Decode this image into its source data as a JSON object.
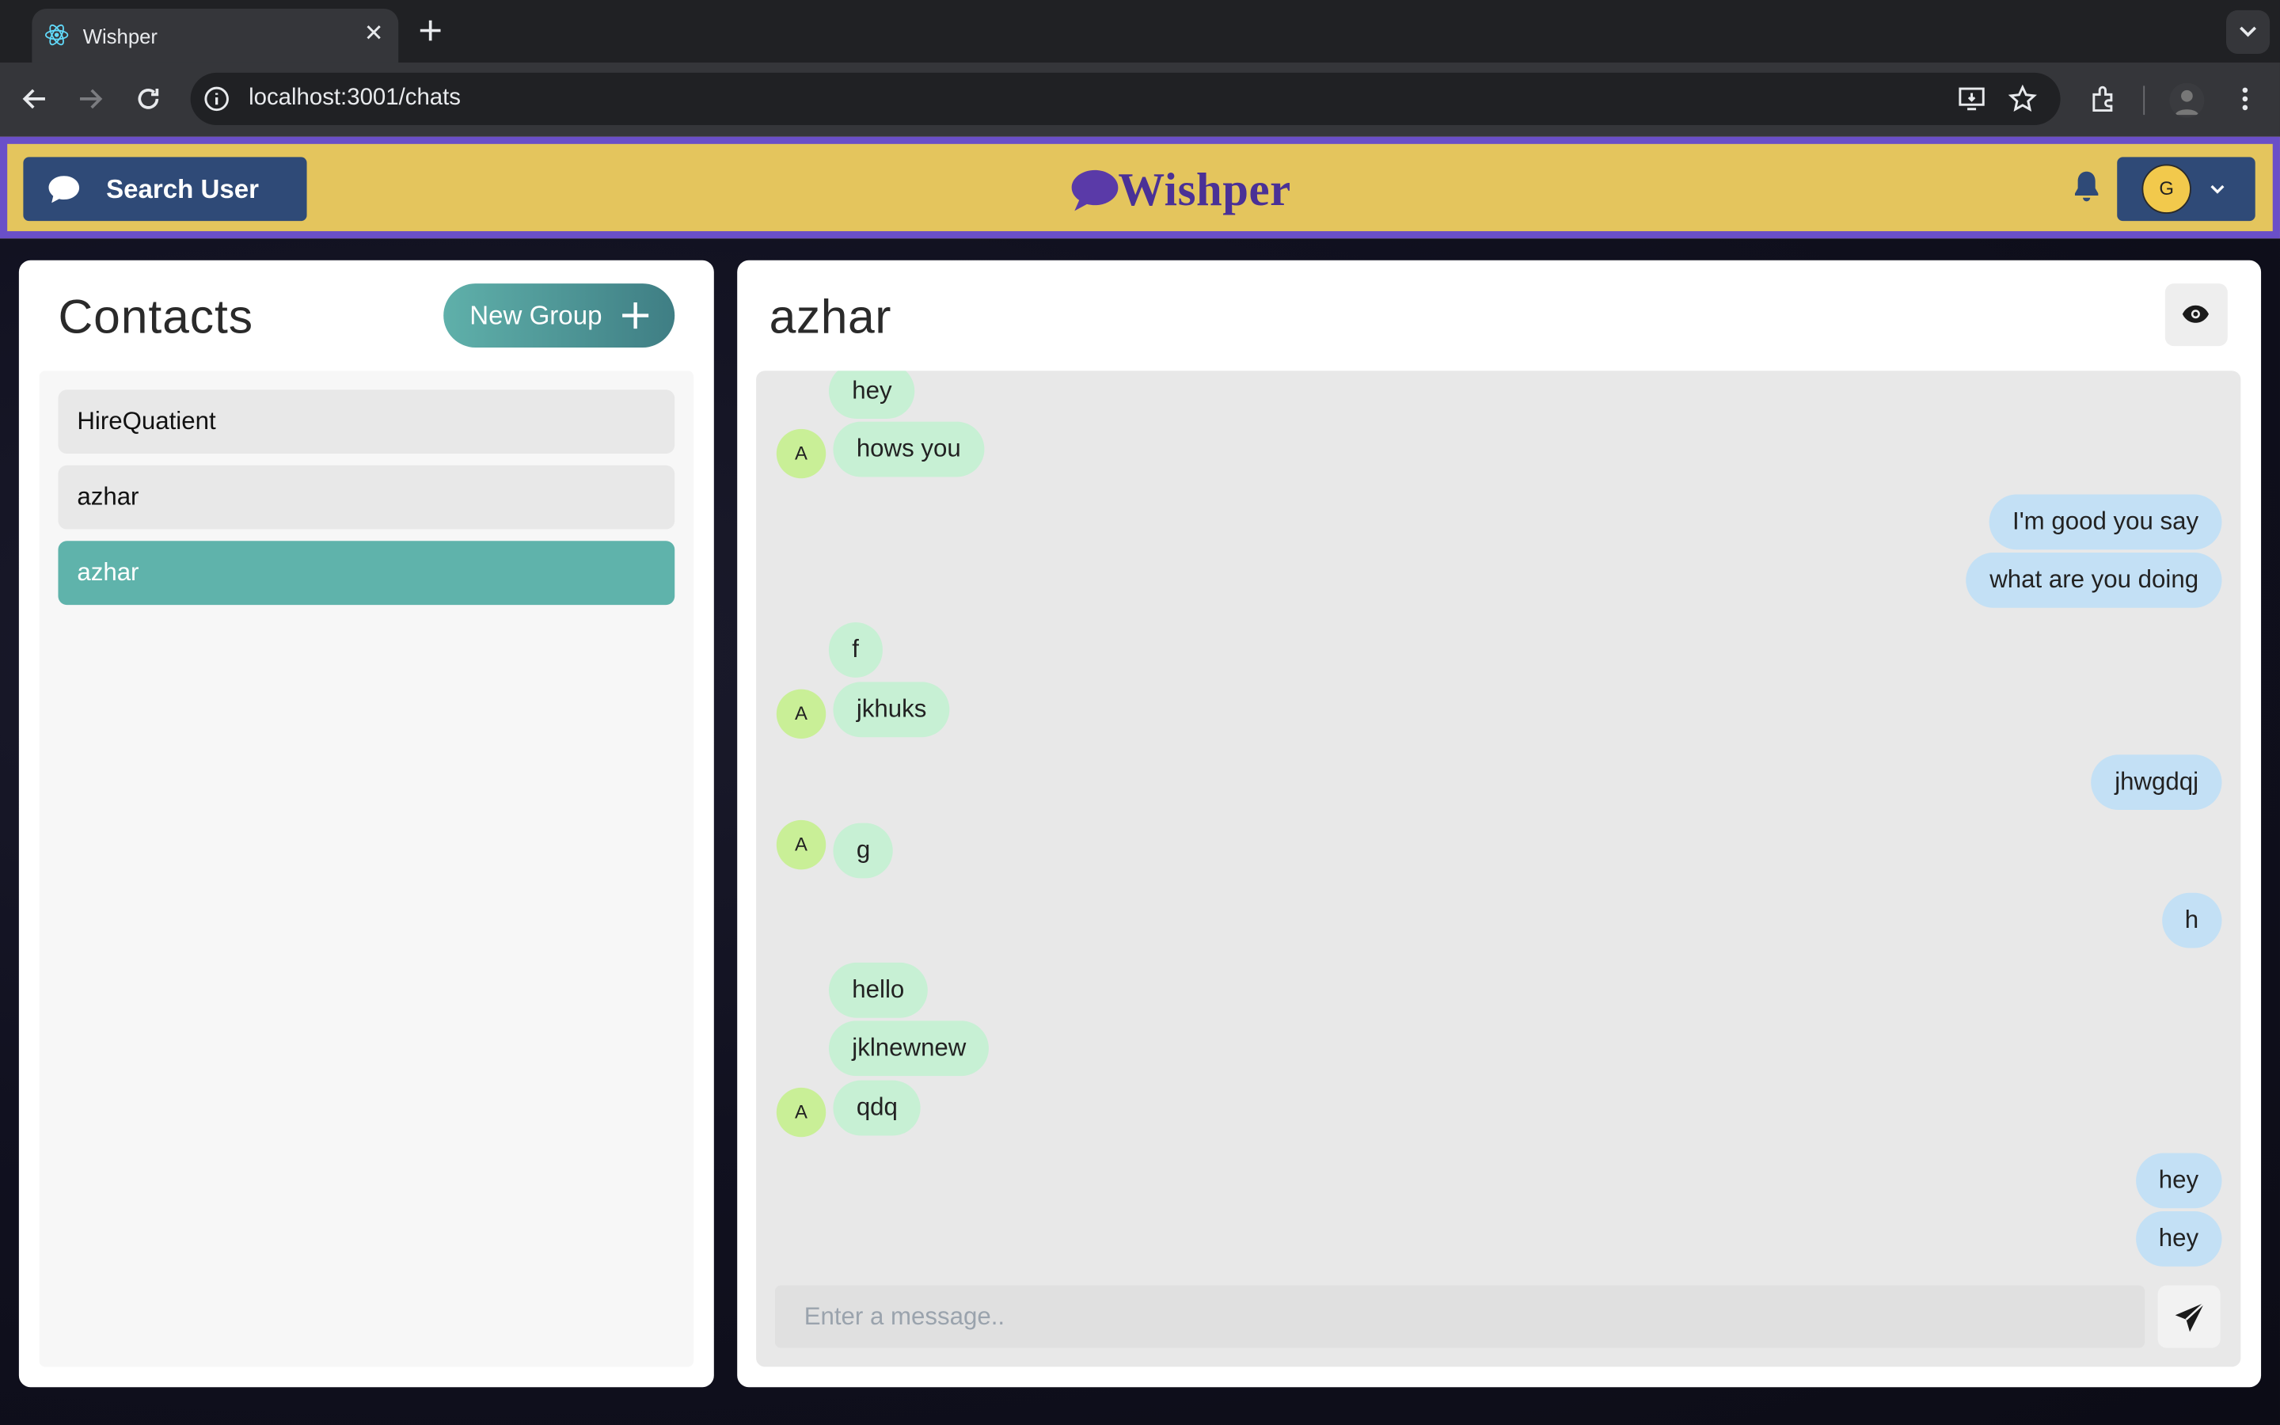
{
  "browser": {
    "tab_title": "Wishper",
    "url": "localhost:3001/chats"
  },
  "header": {
    "search_label": "Search User",
    "logo_text": "Wishper",
    "avatar_initial": "G",
    "brand_colors": {
      "bar": "#e4c55d",
      "border": "#6a4fc8",
      "button": "#2f4a77",
      "logo": "#4a3196"
    }
  },
  "contacts": {
    "title": "Contacts",
    "new_group_label": "New Group",
    "items": [
      {
        "name": "HireQuatient",
        "active": false
      },
      {
        "name": "azhar",
        "active": false
      },
      {
        "name": "azhar",
        "active": true
      }
    ]
  },
  "chat": {
    "title": "azhar",
    "messages": [
      {
        "text": "hey",
        "dir": "in",
        "avatar": null
      },
      {
        "text": "hows you",
        "dir": "in",
        "avatar": "A"
      },
      {
        "text": "I'm good you say",
        "dir": "out"
      },
      {
        "text": "what are you doing",
        "dir": "out"
      },
      {
        "text": "f",
        "dir": "in",
        "avatar": null
      },
      {
        "text": "jkhuks",
        "dir": "in",
        "avatar": "A"
      },
      {
        "text": "jhwgdqj",
        "dir": "out"
      },
      {
        "text": "g",
        "dir": "in",
        "avatar": "A"
      },
      {
        "text": "h",
        "dir": "out"
      },
      {
        "text": "hello",
        "dir": "in",
        "avatar": null
      },
      {
        "text": "jklnewnew",
        "dir": "in",
        "avatar": null
      },
      {
        "text": "qdq",
        "dir": "in",
        "avatar": "A"
      },
      {
        "text": "hey",
        "dir": "out"
      },
      {
        "text": "hey",
        "dir": "out"
      }
    ],
    "composer_placeholder": "Enter a message.."
  }
}
